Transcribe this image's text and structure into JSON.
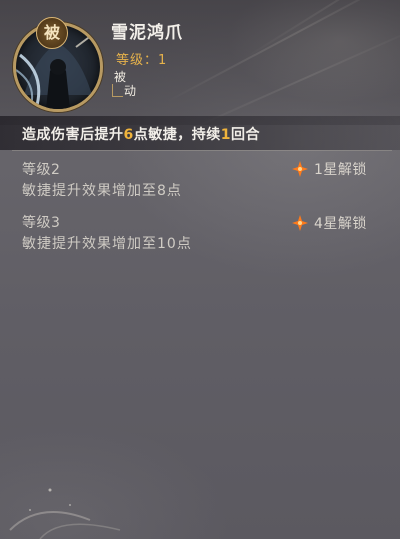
{
  "skill": {
    "icon_badge": "被",
    "name": "雪泥鸿爪",
    "level_text": "等级：1",
    "type_chars": [
      "被",
      "动"
    ],
    "effect": {
      "part1": "造成伤害后提升",
      "value1": "6",
      "part2": "点敏捷，持续",
      "value2": "1",
      "part3": "回合"
    }
  },
  "upgrades": [
    {
      "level": "等级2",
      "description": "敏捷提升效果增加至8点",
      "unlock": "1星解锁",
      "icon": "orange-star-icon"
    },
    {
      "level": "等级3",
      "description": "敏捷提升效果增加至10点",
      "unlock": "4星解锁",
      "icon": "orange-star-icon"
    }
  ],
  "colors": {
    "highlight": "#f0b43c",
    "star": "#ff7a1a",
    "level_text": "#e6b24b",
    "icon_border": "#b89a62"
  }
}
